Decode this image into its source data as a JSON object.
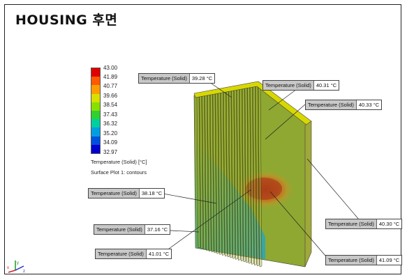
{
  "title": "HOUSING 후면",
  "legend": {
    "values": [
      "43.00",
      "41.89",
      "40.77",
      "39.66",
      "38.54",
      "37.43",
      "36.32",
      "35.20",
      "34.09",
      "32.97"
    ],
    "colors": [
      "#e00000",
      "#ff5a00",
      "#ff9d00",
      "#d8e000",
      "#88e000",
      "#30d030",
      "#00d0a0",
      "#00a0e0",
      "#0050e0",
      "#0000d0"
    ],
    "caption": "Temperature (Solid) [°C]",
    "plot_caption": "Surface Plot 1: contours"
  },
  "probes": [
    {
      "label": "Temperature (Solid)",
      "value": "39.28 °C"
    },
    {
      "label": "Temperature (Solid)",
      "value": "40.31 °C"
    },
    {
      "label": "Temperature (Solid)",
      "value": "40.33 °C"
    },
    {
      "label": "Temperature (Solid)",
      "value": "38.18 °C"
    },
    {
      "label": "Temperature (Solid)",
      "value": "37.16 °C"
    },
    {
      "label": "Temperature (Solid)",
      "value": "41.01 °C"
    },
    {
      "label": "Temperature (Solid)",
      "value": "40.30 °C"
    },
    {
      "label": "Temperature (Solid)",
      "value": "41.09 °C"
    }
  ],
  "triad": {
    "x": "x",
    "y": "y",
    "z": "z",
    "icon": "axis-triad-icon"
  }
}
